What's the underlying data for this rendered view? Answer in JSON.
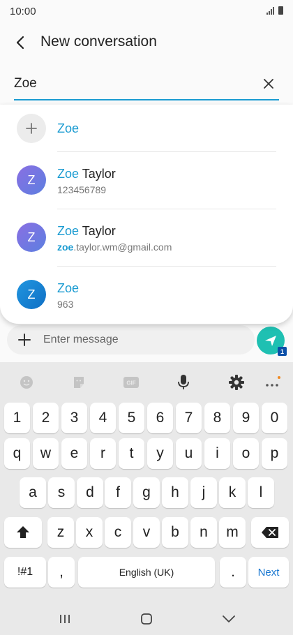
{
  "status_bar": {
    "time": "10:00"
  },
  "header": {
    "title": "New conversation"
  },
  "recipient": {
    "value": "Zoe"
  },
  "suggestions": [
    {
      "type": "add",
      "name_highlight": "Zoe",
      "name_rest": ""
    },
    {
      "type": "contact",
      "avatar_letter": "Z",
      "avatar_color": "#7a6fe2",
      "name_highlight": "Zoe",
      "name_rest": " Taylor",
      "sub_highlight": "",
      "sub_rest": "123456789"
    },
    {
      "type": "contact",
      "avatar_letter": "Z",
      "avatar_color": "#7a6fe2",
      "name_highlight": "Zoe",
      "name_rest": " Taylor",
      "sub_highlight": "zoe",
      "sub_rest": ".taylor.wm@gmail.com"
    },
    {
      "type": "contact",
      "avatar_letter": "Z",
      "avatar_color": "#1a86d6",
      "name_highlight": "Zoe",
      "name_rest": "",
      "sub_highlight": "",
      "sub_rest": "963"
    }
  ],
  "compose": {
    "placeholder": "Enter message",
    "sim_badge": "1"
  },
  "keyboard": {
    "toolbar_icons": [
      "emoji-icon",
      "sticker-icon",
      "gif-icon",
      "microphone-icon",
      "settings-icon",
      "more-icon"
    ],
    "gif_label": "GIF",
    "row_numbers": [
      "1",
      "2",
      "3",
      "4",
      "5",
      "6",
      "7",
      "8",
      "9",
      "0"
    ],
    "row_q": [
      "q",
      "w",
      "e",
      "r",
      "t",
      "y",
      "u",
      "i",
      "o",
      "p"
    ],
    "row_a": [
      "a",
      "s",
      "d",
      "f",
      "g",
      "h",
      "j",
      "k",
      "l"
    ],
    "row_z": [
      "z",
      "x",
      "c",
      "v",
      "b",
      "n",
      "m"
    ],
    "symbols_label": "!#1",
    "comma_label": ",",
    "space_label": "English (UK)",
    "period_label": ".",
    "next_label": "Next"
  },
  "colors": {
    "accent": "#1a9bd1",
    "send": "#1fc0b2",
    "keyboard_bg": "#e9e9e9"
  }
}
